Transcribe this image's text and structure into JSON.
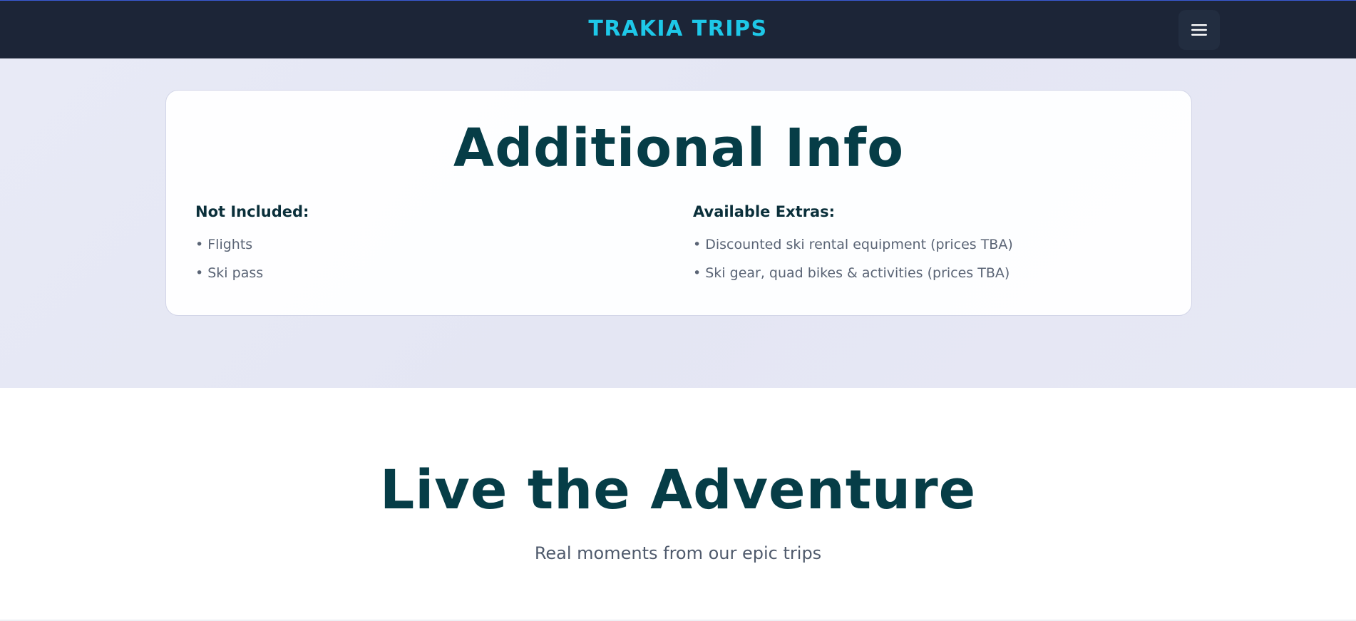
{
  "header": {
    "brand": "TRAKIA TRIPS",
    "menu_icon": "hamburger-menu-icon",
    "background": "#1c2537",
    "brand_color": "#1ec8e8"
  },
  "info": {
    "title": "Additional Info",
    "not_included": {
      "heading": "Not Included:",
      "items": [
        "• Flights",
        "• Ski pass"
      ]
    },
    "extras": {
      "heading": "Available Extras:",
      "items": [
        "• Discounted ski rental equipment (prices TBA)",
        "• Ski gear, quad bikes & activities (prices TBA)"
      ]
    }
  },
  "adventure": {
    "title": "Live the Adventure",
    "subtitle": "Real moments from our epic trips"
  },
  "colors": {
    "heading": "#063d47",
    "body_text": "#5a6475",
    "section_bg": "#e6e8f5"
  }
}
